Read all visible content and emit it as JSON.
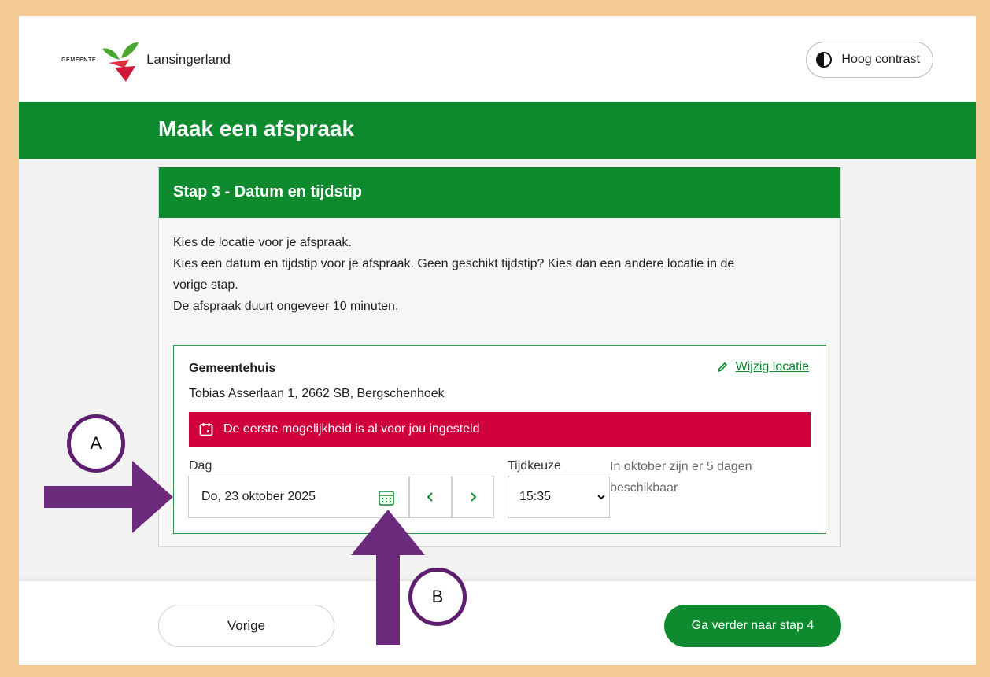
{
  "header": {
    "logo_small": "GEMEENTE",
    "logo_name": "Lansingerland",
    "contrast_label": "Hoog contrast"
  },
  "hero": {
    "title": "Maak een afspraak"
  },
  "step": {
    "title": "Stap 3 - Datum en tijdstip",
    "intro": [
      "Kies de locatie voor je afspraak.",
      "Kies een datum en tijdstip voor je afspraak. Geen geschikt tijdstip? Kies dan een andere locatie in de",
      "vorige stap.",
      "De afspraak duurt ongeveer 10 minuten."
    ]
  },
  "location": {
    "name": "Gemeentehuis",
    "change_label": "Wijzig locatie",
    "address": "Tobias Asserlaan 1, 2662 SB, Bergschenhoek",
    "alert": "De eerste mogelijkheid is al voor jou ingesteld"
  },
  "form": {
    "day_label": "Dag",
    "day_value": "Do, 23 oktober 2025",
    "time_label": "Tijdkeuze",
    "time_value": "15:35",
    "availability_line1": "In oktober zijn er 5 dagen",
    "availability_line2": "beschikbaar"
  },
  "footer": {
    "prev_label": "Vorige",
    "next_label": "Ga verder naar stap 4"
  },
  "annotations": {
    "a_label": "A",
    "b_label": "B"
  },
  "colors": {
    "brand_green": "#0e8a2f",
    "alert_red": "#d0003c",
    "annotation_purple": "#5e1d6e",
    "frame": "#f5c993"
  }
}
